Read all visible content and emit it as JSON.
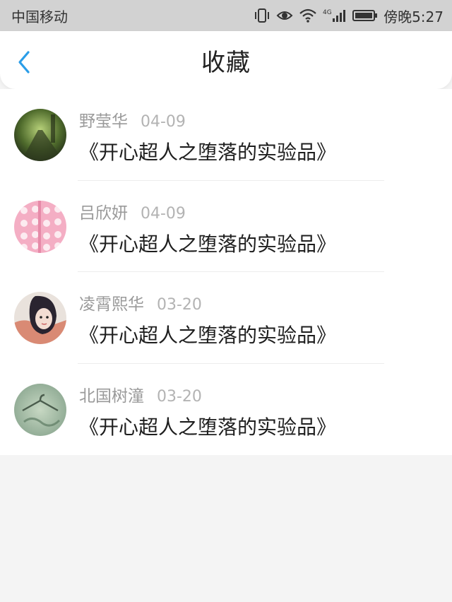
{
  "status_bar": {
    "carrier": "中国移动",
    "network": "4G",
    "time": "傍晚5:27"
  },
  "nav": {
    "title": "收藏"
  },
  "favorites": [
    {
      "name": "野莹华",
      "date": "04-09",
      "title": "《开心超人之堕落的实验品》"
    },
    {
      "name": "吕欣妍",
      "date": "04-09",
      "title": "《开心超人之堕落的实验品》"
    },
    {
      "name": "凌霄熙华",
      "date": "03-20",
      "title": "《开心超人之堕落的实验品》"
    },
    {
      "name": "北国树潼",
      "date": "03-20",
      "title": "《开心超人之堕落的实验品》"
    }
  ],
  "colors": {
    "accent": "#2a9de8",
    "status_bar_bg": "#d2d2d2",
    "page_bg": "#f4f4f4"
  }
}
